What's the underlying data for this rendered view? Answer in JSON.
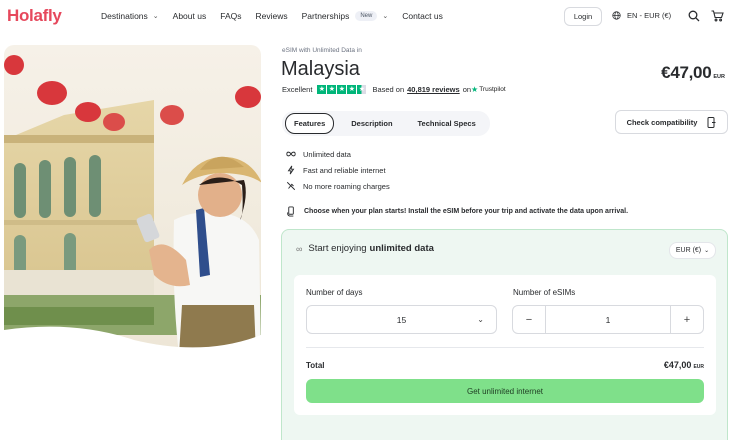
{
  "brand": {
    "logo": "Holafly",
    "accent": "#E6485C"
  },
  "nav": {
    "destinations": "Destinations",
    "about": "About us",
    "faqs": "FAQs",
    "reviews": "Reviews",
    "partnerships": "Partnerships",
    "new_badge": "New",
    "contact": "Contact us",
    "login": "Login",
    "language": "EN - EUR (€)"
  },
  "product": {
    "kicker": "eSIM with Unlimited Data in",
    "title": "Malaysia",
    "price": "€47,00",
    "price_currency": "EUR",
    "rating_label": "Excellent",
    "rating_stars": 4.5,
    "reviews_prefix": "Based on",
    "reviews_count": "40,819 reviews",
    "reviews_on": "on",
    "trustpilot": "Trustpilot"
  },
  "tabs": [
    {
      "label": "Features",
      "active": true
    },
    {
      "label": "Description",
      "active": false
    },
    {
      "label": "Technical Specs",
      "active": false
    }
  ],
  "check_compatibility": "Check compatibility",
  "features": [
    {
      "icon": "infinity-icon",
      "text": "Unlimited data"
    },
    {
      "icon": "lightning-icon",
      "text": "Fast and reliable internet"
    },
    {
      "icon": "no-roaming-icon",
      "text": "No more roaming charges"
    }
  ],
  "note": "Choose when your plan starts! Install the eSIM before your trip and activate the data upon arrival.",
  "plan": {
    "heading_prefix": "Start enjoying",
    "heading_bold": "unlimited data",
    "currency_select": "EUR (€)",
    "days_label": "Number of days",
    "days_value": "15",
    "esims_label": "Number of eSIMs",
    "esims_value": "1",
    "total_label": "Total",
    "total_price": "€47,00",
    "total_currency": "EUR",
    "cta": "Get unlimited internet",
    "cta_color": "#7FE08A"
  }
}
